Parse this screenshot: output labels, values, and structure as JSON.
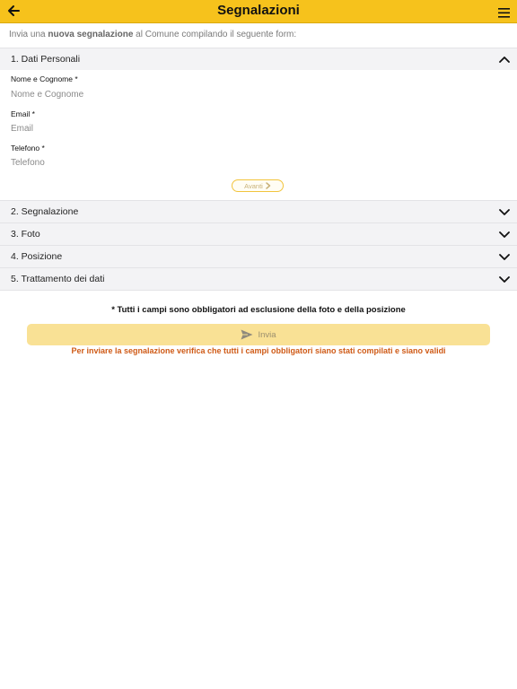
{
  "header": {
    "title": "Segnalazioni",
    "back_icon": "arrow-left-icon",
    "menu_icon": "hamburger-menu-icon",
    "color": "#f6c21c"
  },
  "intro": {
    "prefix": "Invia una ",
    "bold": "nuova segnalazione",
    "suffix": " al Comune compilando il seguente form:"
  },
  "sections": [
    {
      "label": "1. Dati Personali",
      "expanded": true
    },
    {
      "label": "2. Segnalazione",
      "expanded": false
    },
    {
      "label": "3. Foto",
      "expanded": false
    },
    {
      "label": "4. Posizione",
      "expanded": false
    },
    {
      "label": "5. Trattamento dei dati",
      "expanded": false
    }
  ],
  "fields": [
    {
      "label": "Nome e Cognome *",
      "placeholder": "Nome e Cognome",
      "value": ""
    },
    {
      "label": "Email *",
      "placeholder": "Email",
      "value": ""
    },
    {
      "label": "Telefono *",
      "placeholder": "Telefono",
      "value": ""
    }
  ],
  "next_button": {
    "label": "Avanti",
    "icon": "chevron-right-icon"
  },
  "required_note": "* Tutti i campi sono obbligatori ad esclusione della foto e della posizione",
  "submit_button": {
    "label": "Invia",
    "icon": "send-icon",
    "enabled": false
  },
  "validation_message": "Per inviare la segnalazione verifica che tutti i campi obbligatori siano stati compilati e siano validi",
  "colors": {
    "accent": "#f6c21c",
    "warning": "#cf5a16",
    "disabled_button": "#f9e195"
  }
}
